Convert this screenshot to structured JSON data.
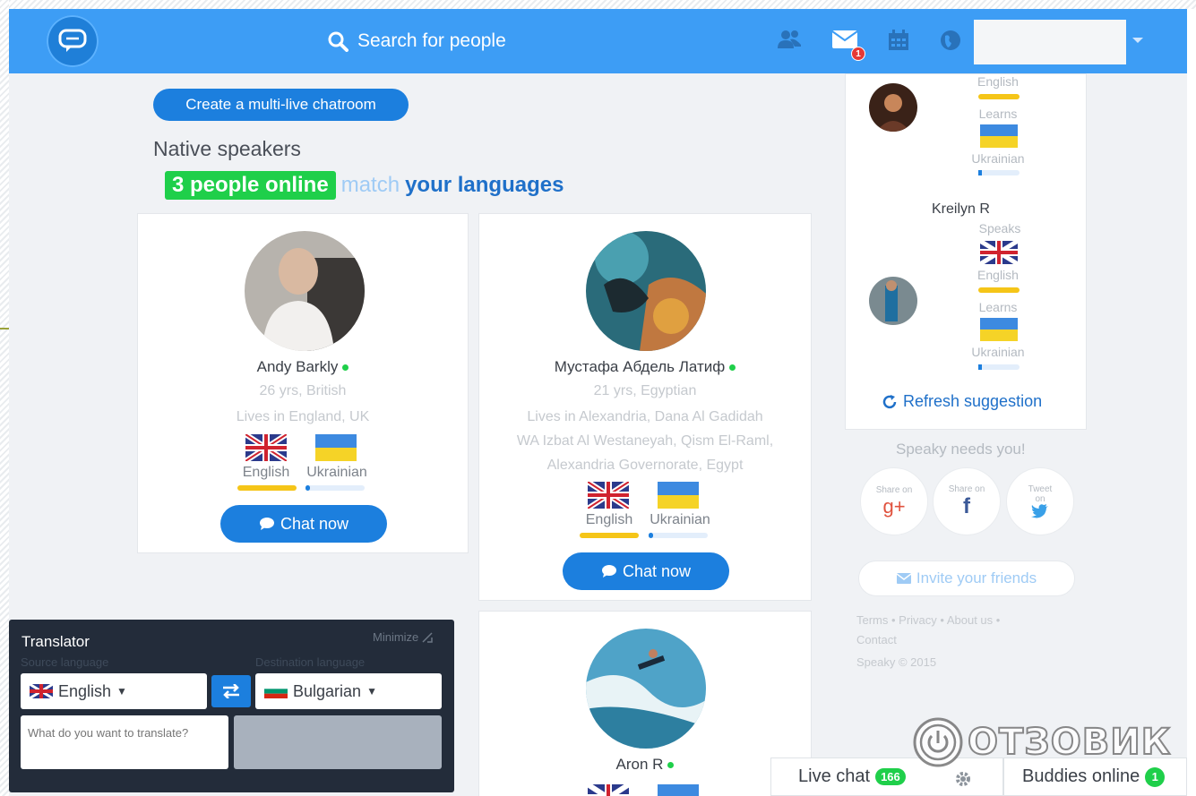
{
  "header": {
    "search_label": "Search for people",
    "messages_badge": "1"
  },
  "main": {
    "create_button": "Create a multi-live chatroom",
    "section_title": "Native speakers",
    "online_count": "3 people online",
    "match_word": "match",
    "langs_word": "your languages",
    "chat_button": "Chat now",
    "people": [
      {
        "name": "Andy Barkly",
        "age": "26 yrs, British",
        "lives": "Lives in England, UK",
        "speaks": "English",
        "learns": "Ukrainian"
      },
      {
        "name": "Мустафа Абдель Латиф",
        "age": "21 yrs, Egyptian",
        "lives_1": "Lives in Alexandria, Dana Al Gadidah",
        "lives_2": "WA Izbat Al Westaneyah, Qism El-Raml,",
        "lives_3": "Alexandria Governorate, Egypt",
        "speaks": "English",
        "learns": "Ukrainian"
      },
      {
        "name": "Aron R"
      }
    ]
  },
  "sidebar": {
    "suggestion_1": {
      "speaks": "English",
      "learns_label": "Learns",
      "learns": "Ukrainian"
    },
    "suggestion_2": {
      "name": "Kreilyn R",
      "speaks_label": "Speaks",
      "speaks": "English",
      "learns_label": "Learns",
      "learns": "Ukrainian"
    },
    "refresh": "Refresh suggestion",
    "needs": "Speaky needs you!",
    "share_google_1": "Share on",
    "share_google_icon": "g+",
    "share_facebook_1": "Share on",
    "share_facebook_icon": "f",
    "share_twitter_1": "Tweet",
    "share_twitter_2": "on",
    "invite": "Invite your friends",
    "footer_1": "Terms • Privacy • About us •",
    "footer_2": "Contact",
    "copyright": "Speaky © 2015"
  },
  "translator": {
    "title": "Translator",
    "minimize": "Minimize",
    "source_label": "Source language",
    "dest_label": "Destination language",
    "source_value": "English",
    "dest_value": "Bulgarian",
    "input_placeholder": "What do you want to translate?"
  },
  "bottom": {
    "live_chat": "Live chat",
    "live_count": "166",
    "buddies": "Buddies online",
    "buddies_count": "1"
  },
  "watermark": {
    "text": "ОТЗОВИК"
  },
  "colors": {
    "header": "#3d9df5",
    "accent": "#1c7fde",
    "online": "#1fcf4a",
    "speak_level": "#f5c518",
    "learn_level": "#1c7fde"
  },
  "levels": {
    "english_speak": 1.0,
    "ukrainian_learn": 0.08
  }
}
